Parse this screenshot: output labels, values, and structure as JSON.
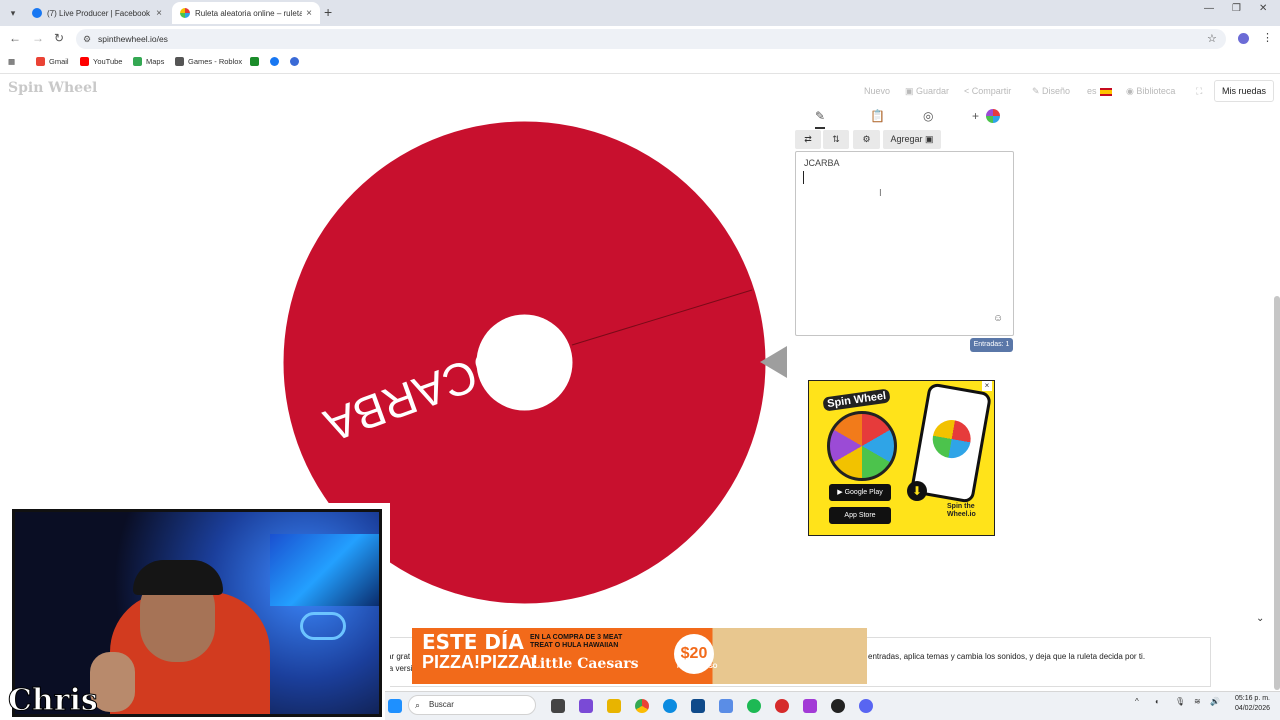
{
  "browser": {
    "tabs": [
      {
        "title": "(7) Live Producer | Facebook"
      },
      {
        "title": "Ruleta aleatoria online – ruleta"
      }
    ],
    "url": "spinthewheel.io/es",
    "bookmarks": [
      "Gmail",
      "YouTube",
      "Maps",
      "Games - Roblox"
    ]
  },
  "app": {
    "logo": "Spin Wheel",
    "header_links": [
      "Nuevo",
      "Guardar",
      "Compartir",
      "Diseño",
      "es",
      "Biblioteca"
    ],
    "my_wheels": "Mis ruedas"
  },
  "wheel": {
    "entry": "JCARBA",
    "color": "#c8102e"
  },
  "panel": {
    "add_button": "Agregar",
    "entries_text": "JCARBA",
    "count_label": "Entradas: 1"
  },
  "ad": {
    "logo": "Spin Wheel",
    "google_play": "Google Play",
    "app_store": "App Store",
    "brand": "Spin the Wheel.io"
  },
  "bottom": {
    "desc_left": "ar grat",
    "desc_left2": "la versi",
    "desc_right": "entradas, aplica temas y cambia los sonidos, y deja que la ruleta decida por ti.",
    "banner": {
      "line1": "ESTE DÍA",
      "line2": "PIZZA!PIZZA!",
      "offer": "EN LA COMPRA DE 3 MEAT TREAT O HULA HAWAIIAN",
      "brand": "Little Caesars",
      "price": "$20",
      "price_sub": "PIZZA QUESO"
    }
  },
  "webcam": {
    "name": "Chris"
  },
  "taskbar": {
    "search": "Buscar",
    "time": "05:16 p. m.",
    "date": "04/02/2026"
  }
}
